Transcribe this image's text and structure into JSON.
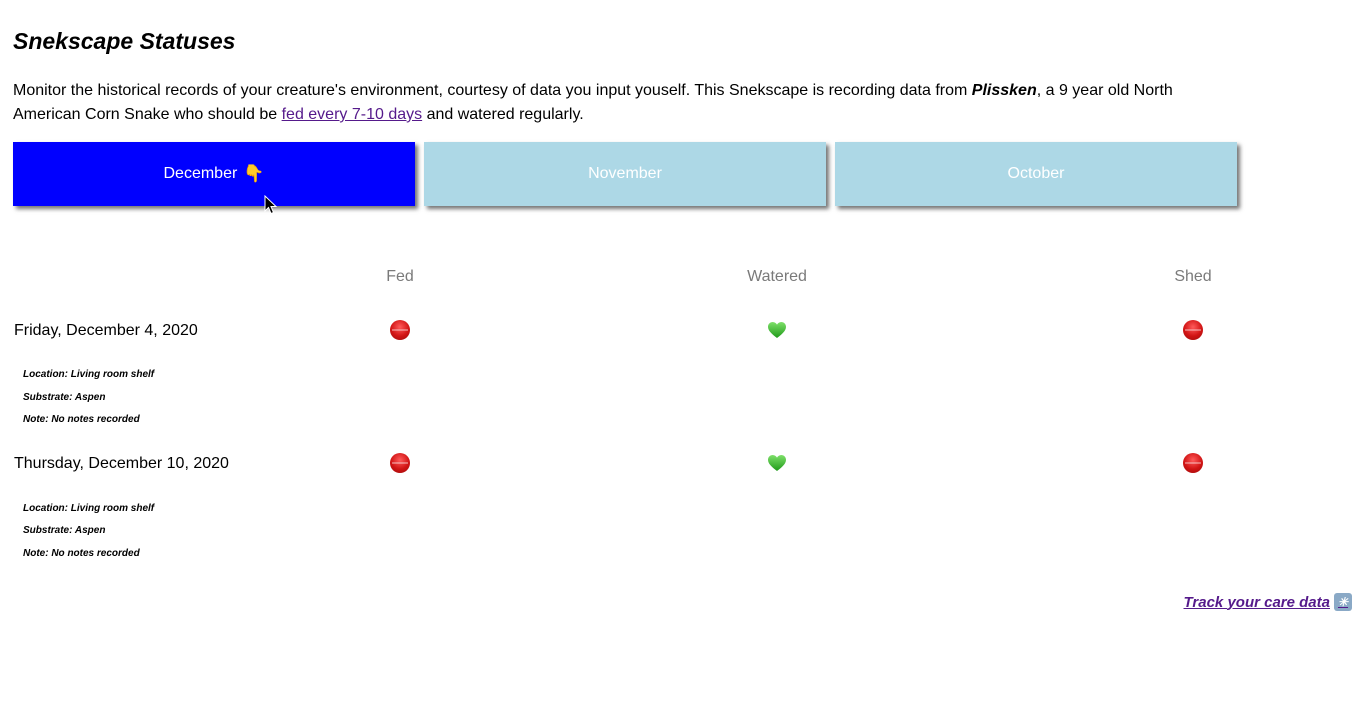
{
  "page": {
    "title": "Snekscape Statuses",
    "intro": {
      "before_name": "Monitor the historical records of your creature's environment, courtesy of data you input youself. This Snekscape is recording data from ",
      "name": "Plissken",
      "after_name": ", a 9 year old North American Corn Snake who should be ",
      "link_text": "fed every 7-10 days",
      "after_link": " and watered regularly."
    }
  },
  "tabs": [
    {
      "label": "December",
      "emoji": "👇",
      "active": true
    },
    {
      "label": "November",
      "active": false
    },
    {
      "label": "October",
      "active": false
    }
  ],
  "columns": {
    "fed": "Fed",
    "watered": "Watered",
    "shed": "Shed"
  },
  "records": [
    {
      "date": "Friday, December 4, 2020",
      "fed": "red-circle-icon",
      "watered": "green-heart-icon",
      "shed": "red-circle-icon",
      "location": "Location: Living room shelf",
      "substrate": "Substrate: Aspen",
      "note": "Note: No notes recorded"
    },
    {
      "date": "Thursday, December 10, 2020",
      "fed": "red-circle-icon",
      "watered": "green-heart-icon",
      "shed": "red-circle-icon",
      "location": "Location: Living room shelf",
      "substrate": "Substrate: Aspen",
      "note": "Note: No notes recorded"
    }
  ],
  "footer": {
    "track_link": "Track your care data",
    "track_icon": "sparkle-box-icon"
  },
  "colors": {
    "active_tab": "#0000ff",
    "inactive_tab": "#add8e6",
    "link": "#551a8b"
  }
}
